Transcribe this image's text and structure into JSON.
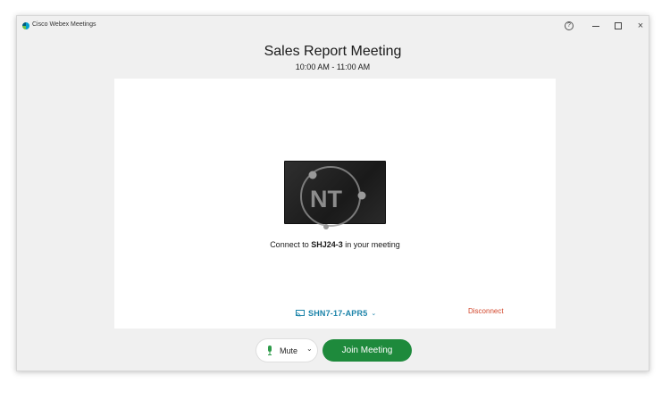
{
  "window": {
    "app_title": "Cisco Webex Meetings"
  },
  "titlebar": {
    "help_symbol": "?",
    "close_symbol": "×"
  },
  "meeting": {
    "title": "Sales Report Meeting",
    "time": "10:00 AM - 11:00 AM"
  },
  "device_card": {
    "watermark": "NT",
    "connect_prefix": "Connect to ",
    "device_id": "SHJ24-3",
    "connect_suffix": " in your meeting",
    "selected_device": "SHN7-17-APR5",
    "disconnect_label": "Disconnect"
  },
  "controls": {
    "mute_label": "Mute",
    "join_label": "Join Meeting"
  },
  "colors": {
    "accent_blue": "#1b83a9",
    "join_green": "#1e8a3c",
    "disconnect_red": "#d2452a"
  }
}
